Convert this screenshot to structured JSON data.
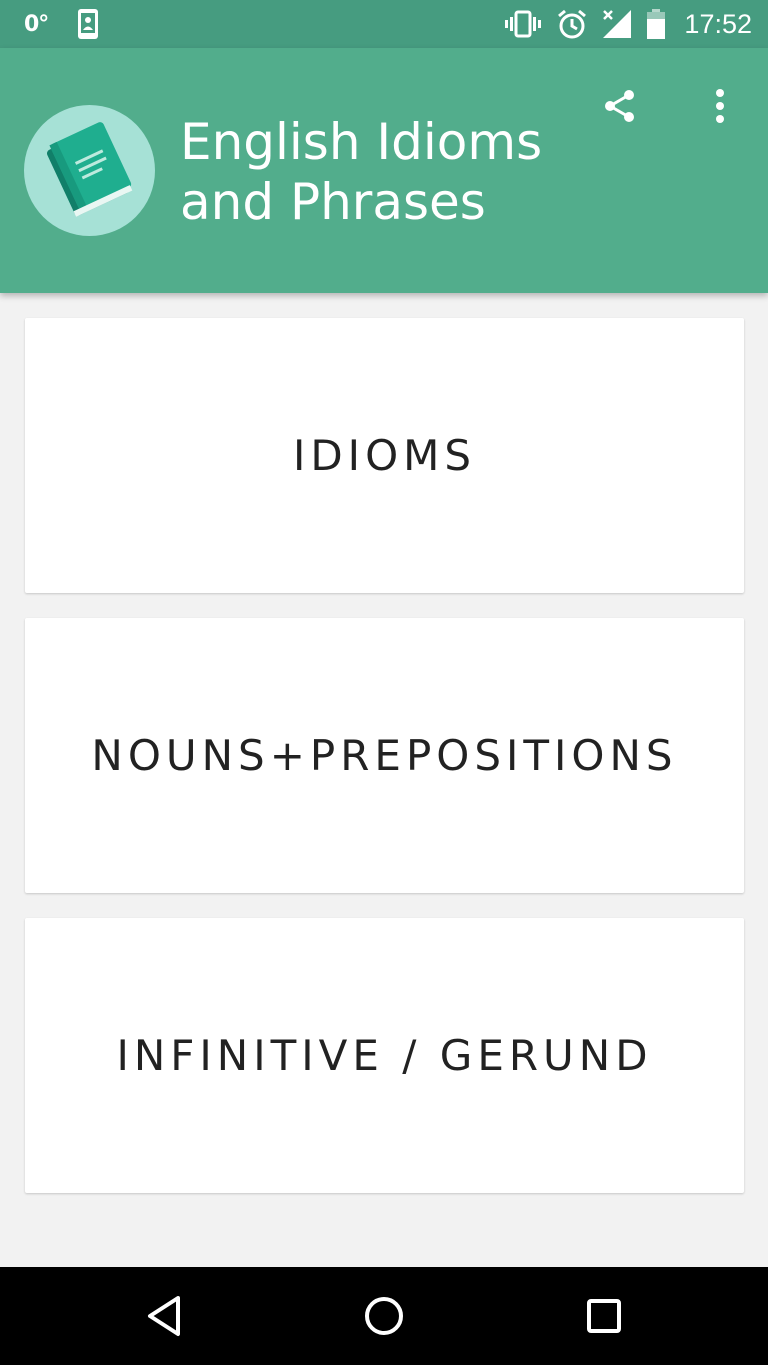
{
  "status_bar": {
    "temperature": "0°",
    "time": "17:52",
    "icons": [
      "weather-icon",
      "device-admin-icon",
      "vibrate-icon",
      "alarm-icon",
      "no-signal-icon",
      "battery-icon"
    ]
  },
  "app_bar": {
    "title": "English Idioms and Phrases",
    "logo_icon": "book-icon",
    "actions": [
      "share-icon",
      "more-vert-icon"
    ]
  },
  "menu": {
    "items": [
      {
        "label": "IDIOMS"
      },
      {
        "label": "NOUNS+PREPOSITIONS"
      },
      {
        "label": "INFINITIVE / GERUND"
      }
    ]
  },
  "nav_bar": {
    "icons": [
      "back-icon",
      "home-icon",
      "recents-icon"
    ]
  },
  "colors": {
    "status_bar": "#469c80",
    "app_bar": "#52ad8c",
    "logo_circle": "#a6e1d6",
    "book": "#1fae8f",
    "background": "#f2f2f2"
  }
}
